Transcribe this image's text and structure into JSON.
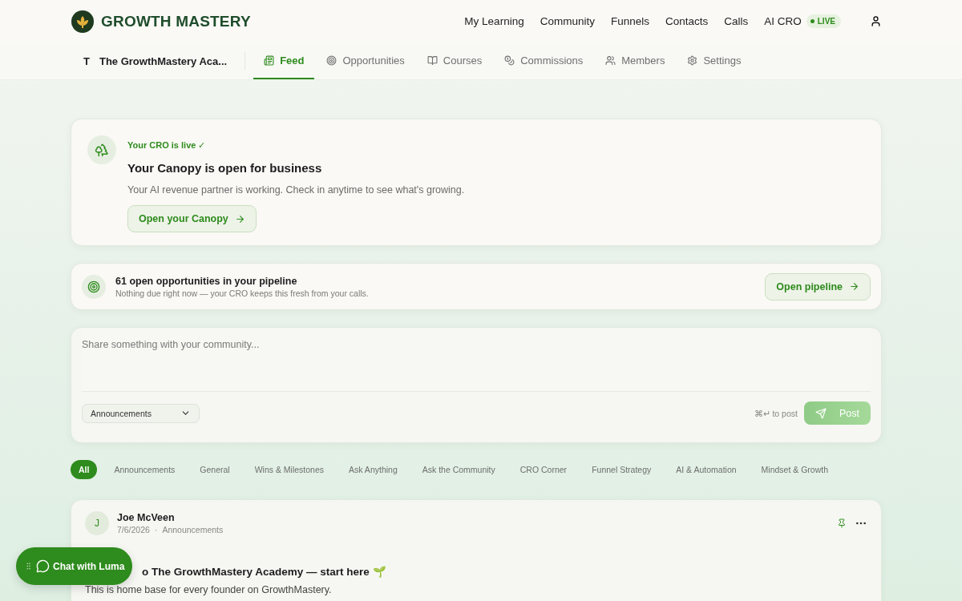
{
  "header": {
    "brand": "GROWTH MASTERY",
    "nav": [
      {
        "label": "My Learning"
      },
      {
        "label": "Community"
      },
      {
        "label": "Funnels"
      },
      {
        "label": "Contacts"
      },
      {
        "label": "Calls"
      },
      {
        "label": "AI CRO",
        "badge": "LIVE"
      }
    ]
  },
  "subnav": {
    "initial": "T",
    "community": "The GrowthMastery Aca...",
    "tabs": [
      {
        "label": "Feed",
        "selected": true
      },
      {
        "label": "Opportunities",
        "selected": false
      },
      {
        "label": "Courses",
        "selected": false
      },
      {
        "label": "Commissions",
        "selected": false
      },
      {
        "label": "Members",
        "selected": false
      },
      {
        "label": "Settings",
        "selected": false
      }
    ]
  },
  "cro_card": {
    "status": "Your CRO is live",
    "check": "✓",
    "title": "Your Canopy is open for business",
    "text": "Your AI revenue partner is working. Check in anytime to see what's growing.",
    "button": "Open your Canopy"
  },
  "pipeline": {
    "title": "61 open opportunities in your pipeline",
    "subtitle": "Nothing due right now — your CRO keeps this fresh from your calls.",
    "button": "Open pipeline"
  },
  "composer": {
    "placeholder": "Share something with your community...",
    "category": "Announcements",
    "hint": "⌘↵ to post",
    "button": "Post",
    "disabled": true
  },
  "filters": [
    {
      "label": "All",
      "selected": true
    },
    {
      "label": "Announcements",
      "selected": false
    },
    {
      "label": "General",
      "selected": false
    },
    {
      "label": "Wins & Milestones",
      "selected": false
    },
    {
      "label": "Ask Anything",
      "selected": false
    },
    {
      "label": "Ask the Community",
      "selected": false
    },
    {
      "label": "CRO Corner",
      "selected": false
    },
    {
      "label": "Funnel Strategy",
      "selected": false
    },
    {
      "label": "AI & Automation",
      "selected": false
    },
    {
      "label": "Mindset & Growth",
      "selected": false
    }
  ],
  "post": {
    "initial": "J",
    "author": "Joe McVeen",
    "date": "7/6/2026",
    "separator": "·",
    "category": "Announcements",
    "title": "o The GrowthMastery Academy — start here 🌱",
    "body": "This is home base for every founder on GrowthMastery.",
    "pinned": true
  },
  "chat": {
    "label": "Chat with Luma"
  }
}
